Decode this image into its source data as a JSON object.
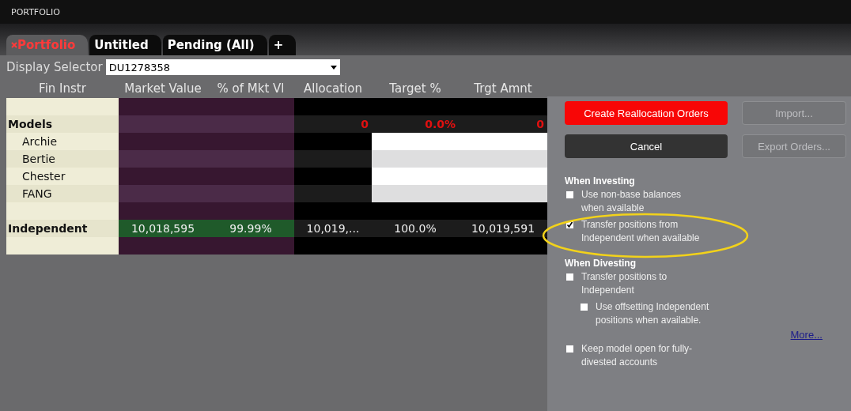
{
  "window": {
    "title": "PORTFOLIO"
  },
  "tabs": [
    {
      "label": "Portfolio",
      "selected": true,
      "closable": true
    },
    {
      "label": "Untitled",
      "selected": false,
      "closable": false
    },
    {
      "label": "Pending (All)",
      "selected": false,
      "closable": false
    },
    {
      "label": "+",
      "selected": false,
      "closable": false
    }
  ],
  "display_selector": {
    "label": "Display Selector",
    "value": "DU1278358"
  },
  "table": {
    "columns": [
      "Fin Instr",
      "Market Value",
      "% of Mkt Vl",
      "Allocation",
      "Target %",
      "Trgt Amnt"
    ],
    "rows": [
      {
        "kind": "spacer",
        "cells": []
      },
      {
        "kind": "group",
        "cells": [
          "Models",
          "",
          "",
          "0",
          "0.0%",
          "0"
        ],
        "negative": true
      },
      {
        "kind": "model",
        "cells": [
          "Archie"
        ]
      },
      {
        "kind": "model",
        "cells": [
          "Bertie"
        ]
      },
      {
        "kind": "model",
        "cells": [
          "Chester"
        ]
      },
      {
        "kind": "model",
        "cells": [
          "FANG"
        ]
      },
      {
        "kind": "spacer",
        "cells": []
      },
      {
        "kind": "group",
        "cells": [
          "Independent",
          "10,018,595",
          "99.99%",
          "10,019,...",
          "100.0%",
          "10,019,591"
        ],
        "negative": false
      },
      {
        "kind": "spacer",
        "cells": []
      }
    ]
  },
  "buttons": [
    {
      "label": "Create Reallocation Orders",
      "kind": "primary",
      "disabled": false
    },
    {
      "label": "Import...",
      "kind": "secondary",
      "disabled": true
    },
    {
      "label": "Cancel",
      "kind": "dark",
      "disabled": false
    },
    {
      "label": "Export Orders...",
      "kind": "secondary",
      "disabled": true
    }
  ],
  "sections": [
    {
      "title": "When Investing",
      "options": [
        {
          "label": "Use non-base balances when available",
          "checked": false
        },
        {
          "label": "Transfer positions from Independent when available",
          "checked": true
        }
      ]
    },
    {
      "title": "When Divesting",
      "options": [
        {
          "label": "Transfer positions to Independent",
          "checked": false,
          "children": [
            {
              "label": "Use offsetting Independent positions when available.",
              "checked": false
            }
          ]
        }
      ]
    }
  ],
  "more_link": "More...",
  "extra_options": [
    {
      "label": "Keep model open for fully-divested accounts",
      "checked": false
    }
  ]
}
